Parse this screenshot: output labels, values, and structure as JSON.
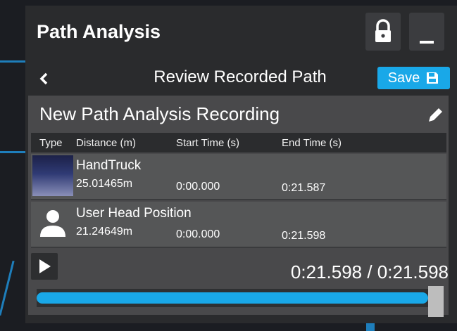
{
  "window": {
    "title": "Path Analysis"
  },
  "header": {
    "back_icon": "chevron-left-icon",
    "title": "Review Recorded Path",
    "save_label": "Save",
    "save_icon": "floppy-disk-icon"
  },
  "titlebar_buttons": {
    "lock_icon": "lock-icon",
    "minimize_icon": "minimize-icon"
  },
  "recording": {
    "name": "New Path Analysis Recording",
    "edit_icon": "pencil-icon"
  },
  "table": {
    "headers": {
      "type": "Type",
      "distance": "Distance (m)",
      "start": "Start Time (s)",
      "end": "End Time (s)"
    },
    "rows": [
      {
        "name": "HandTruck",
        "distance": "25.01465m",
        "start": "0:00.000",
        "end": "0:21.587",
        "thumbnail": "handtruck-thumbnail"
      },
      {
        "name": "User Head Position",
        "distance": "21.24649m",
        "start": "0:00.000",
        "end": "0:21.598",
        "thumbnail": "user-icon"
      }
    ]
  },
  "playback": {
    "play_icon": "play-icon",
    "time": "0:21.598 / 0:21.598",
    "progress": 1.0
  },
  "colors": {
    "accent": "#19a8e8",
    "panel": "#2a2b2d",
    "card": "#49494b",
    "row": "#555657"
  }
}
